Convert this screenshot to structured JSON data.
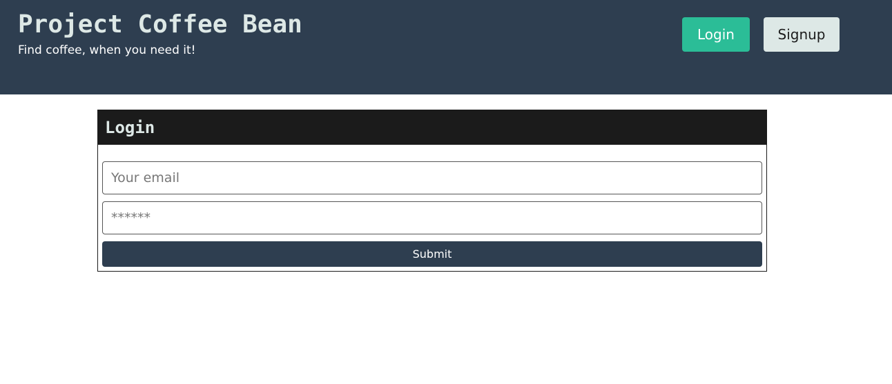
{
  "header": {
    "title": "Project Coffee Bean",
    "tagline": "Find coffee, when you need it!",
    "login_label": "Login",
    "signup_label": "Signup"
  },
  "login_form": {
    "title": "Login",
    "email_placeholder": "Your email",
    "email_value": "",
    "password_placeholder": "******",
    "password_value": "",
    "submit_label": "Submit"
  },
  "colors": {
    "header_bg": "#2e3e50",
    "accent_login": "#2bbd97",
    "signup_bg": "#dde8e6",
    "card_header_bg": "#1b1b1b",
    "submit_bg": "#2e3e50"
  }
}
